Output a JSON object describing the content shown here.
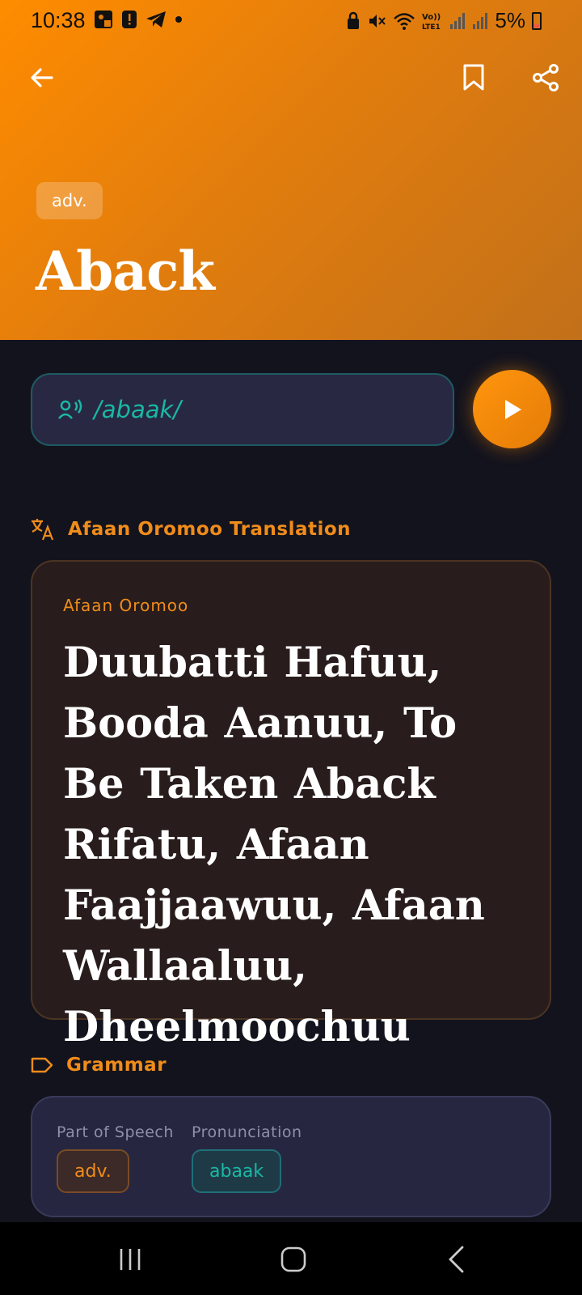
{
  "status_bar": {
    "time": "10:38",
    "battery": "5%",
    "icons_left": [
      "photo-notification-icon",
      "alert-notification-icon",
      "telegram-icon",
      "dot-icon"
    ],
    "icons_right": [
      "lock-icon",
      "mute-icon",
      "wifi-icon",
      "volte-icon",
      "signal-icon",
      "signal-icon",
      "battery-icon"
    ]
  },
  "header": {
    "part_of_speech": "adv.",
    "word": "Aback",
    "accent_color": "#ff8c00"
  },
  "pronunciation": {
    "phonetic": "/abaak/"
  },
  "translation_section": {
    "title": "Afaan Oromoo Translation",
    "card_label": "Afaan Oromoo",
    "text": "Duubatti Hafuu, Booda Aanuu,  To Be Taken Aback Rifatu, Afaan Faajjaawuu, Afaan Wallaaluu, Dheelmoochuu"
  },
  "grammar_section": {
    "title": "Grammar",
    "part_of_speech_label": "Part of Speech",
    "part_of_speech_value": "adv.",
    "pronunciation_label": "Pronunciation",
    "pronunciation_value": "abaak"
  }
}
